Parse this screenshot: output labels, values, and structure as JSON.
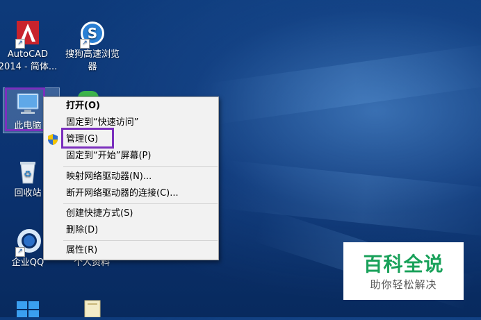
{
  "desktop": {
    "icons": [
      {
        "label_line1": "AutoCAD",
        "label_line2": "2014 - 简体...",
        "icon": "autocad-icon"
      },
      {
        "label_line1": "搜狗高速浏览",
        "label_line2": "器",
        "icon": "sogou-browser-icon"
      },
      {
        "label_line1": "此电脑",
        "icon": "this-pc-icon"
      },
      {
        "label_line1": "回收站",
        "icon": "recycle-bin-icon"
      },
      {
        "label_line1": "企业QQ",
        "icon": "qq-icon"
      },
      {
        "label_line1": "个人资料",
        "icon": "folder-icon"
      }
    ]
  },
  "context_menu": {
    "items": [
      {
        "label": "打开(O)"
      },
      {
        "label": "固定到“快速访问”"
      },
      {
        "label": "管理(G)",
        "icon": "uac-shield-icon"
      },
      {
        "label": "固定到“开始”屏幕(P)"
      },
      {
        "label": "映射网络驱动器(N)..."
      },
      {
        "label": "断开网络驱动器的连接(C)..."
      },
      {
        "label": "创建快捷方式(S)"
      },
      {
        "label": "删除(D)"
      },
      {
        "label": "属性(R)"
      }
    ]
  },
  "watermark": {
    "title": "百科全说",
    "subtitle": "助你轻松解决"
  },
  "colors": {
    "highlight": "#7b2fbd",
    "watermark_green": "#19a15a",
    "desktop_blue": "#0d3a7a"
  }
}
